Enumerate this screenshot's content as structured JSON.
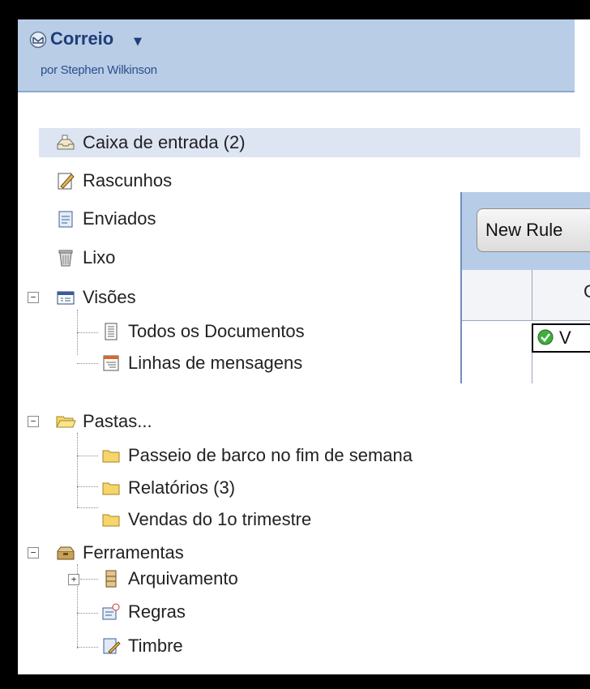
{
  "app": {
    "title": "Correio",
    "subtitle": "por Stephen Wilkinson"
  },
  "tree": {
    "inbox": "Caixa de entrada (2)",
    "drafts": "Rascunhos",
    "sent": "Enviados",
    "trash": "Lixo",
    "views": {
      "label": "Visões",
      "toggle": "−",
      "items": [
        "Todos os Documentos",
        "Linhas de mensagens"
      ]
    },
    "folders": {
      "label": "Pastas...",
      "toggle": "−",
      "items": [
        "Passeio de barco no fim de semana",
        "Relatórios (3)",
        "Vendas do 1o trimestre"
      ]
    },
    "tools": {
      "label": "Ferramentas",
      "toggle": "−",
      "items": [
        "Arquivamento",
        "Regras",
        "Timbre"
      ],
      "archive_toggle": "+"
    }
  },
  "overlay": {
    "button_label": "New Rule",
    "column_header": "C",
    "row_text": "V"
  },
  "colors": {
    "header_bg": "#b9cde6",
    "title": "#1f3d7a",
    "selected_row": "#dde4f2"
  }
}
